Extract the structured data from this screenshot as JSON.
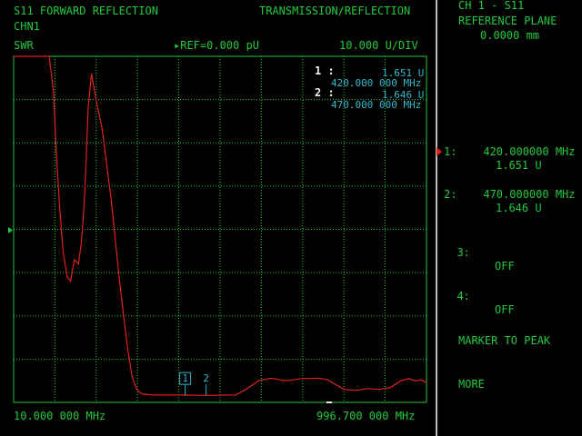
{
  "header": {
    "title_left": "S11 FORWARD REFLECTION",
    "title_right": "TRANSMISSION/REFLECTION",
    "channel": "CHN1",
    "format": "SWR",
    "ref_label": "REF=0.000 pU",
    "scale_label": "10.000 U/DIV"
  },
  "footer": {
    "start": "10.000 000 MHz",
    "stop": "996.700 000 MHz"
  },
  "marker_readout": [
    {
      "id": "1 :",
      "value": "1.651 U",
      "freq": "420.000 000 MHz"
    },
    {
      "id": "2 :",
      "value": "1.646 U",
      "freq": "470.000 000 MHz"
    }
  ],
  "softkeys": {
    "header1": "CH 1 - S11",
    "header2": "REFERENCE PLANE",
    "header3": "0.0000 mm",
    "m1_line1": "1:    420.000000 MHz",
    "m1_line2": "1.651 U",
    "m2_line1": "2:    470.000000 MHz",
    "m2_line2": "1.646 U",
    "m3_label": "3:",
    "m3_value": "OFF",
    "m4_label": "4:",
    "m4_value": "OFF",
    "marker_to_peak": "MARKER TO PEAK",
    "more": "MORE"
  },
  "chart_data": {
    "type": "line",
    "title": "S11 FORWARD REFLECTION",
    "xlabel": "",
    "ylabel": "SWR",
    "x_unit": "MHz",
    "xlim": [
      10.0,
      996.7
    ],
    "ylim": [
      0.0,
      80.0
    ],
    "grid": true,
    "colors": {
      "trace": "#e02020",
      "grid": "#22c83c",
      "marker": "#34b6c8"
    },
    "series": [
      {
        "x": [
          10,
          95,
          105,
          112,
          120,
          128,
          138,
          146,
          155,
          165,
          172,
          178,
          183,
          188,
          196,
          205,
          222,
          243,
          262,
          274,
          283,
          293,
          304,
          316,
          330,
          345,
          362,
          378,
          395,
          410,
          420,
          440,
          470,
          500,
          540,
          565,
          595,
          625,
          660,
          700,
          740,
          760,
          800,
          830,
          855,
          885,
          910,
          935,
          955,
          970,
          985,
          996.7
        ],
        "values": [
          80,
          80,
          72,
          58,
          45,
          35,
          29,
          28,
          33,
          32,
          37,
          45,
          55,
          68,
          76,
          71,
          63,
          47,
          29,
          19,
          12,
          6,
          3,
          2,
          1.8,
          1.7,
          1.7,
          1.7,
          1.7,
          1.7,
          1.65,
          1.65,
          1.646,
          1.65,
          1.7,
          3,
          5,
          5.6,
          5,
          5.5,
          5.6,
          5.2,
          3,
          2.8,
          3.2,
          3,
          3.4,
          5,
          5.5,
          5,
          5.2,
          4.5
        ]
      }
    ],
    "markers": [
      {
        "label": "1",
        "x": 420.0,
        "y": 1.651
      },
      {
        "label": "2",
        "x": 470.0,
        "y": 1.646
      }
    ]
  }
}
